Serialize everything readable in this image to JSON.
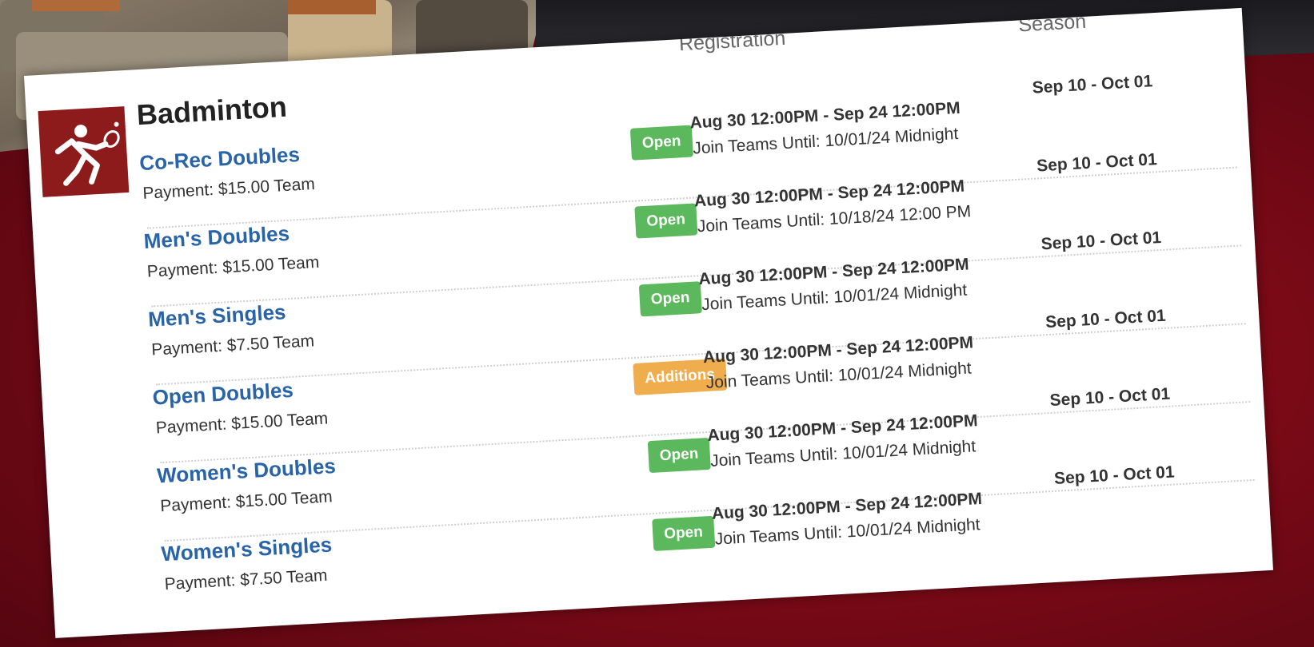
{
  "colors": {
    "open": "#5cb85c",
    "additions": "#f0ad4e",
    "link": "#2a64a8",
    "icon_bg": "#8e1b1b"
  },
  "headers": {
    "registration": "Registration",
    "season": "Season"
  },
  "sport": {
    "title": "Badminton",
    "icon": "badminton-player-icon"
  },
  "leagues": [
    {
      "name": "Co-Rec Doubles",
      "payment": "Payment: $15.00 Team",
      "status": "Open",
      "status_type": "open",
      "registration": "Aug 30 12:00PM - Sep 24 12:00PM",
      "join": "Join Teams Until: 10/01/24 Midnight",
      "season": "Sep 10 - Oct 01"
    },
    {
      "name": "Men's Doubles",
      "payment": "Payment: $15.00 Team",
      "status": "Open",
      "status_type": "open",
      "registration": "Aug 30 12:00PM - Sep 24 12:00PM",
      "join": "Join Teams Until: 10/18/24 12:00 PM",
      "season": "Sep 10 - Oct 01"
    },
    {
      "name": "Men's Singles",
      "payment": "Payment: $7.50 Team",
      "status": "Open",
      "status_type": "open",
      "registration": "Aug 30 12:00PM - Sep 24 12:00PM",
      "join": "Join Teams Until: 10/01/24 Midnight",
      "season": "Sep 10 - Oct 01"
    },
    {
      "name": "Open Doubles",
      "payment": "Payment: $15.00 Team",
      "status": "Additions",
      "status_type": "additions",
      "registration": "Aug 30 12:00PM - Sep 24 12:00PM",
      "join": "Join Teams Until: 10/01/24 Midnight",
      "season": "Sep 10 - Oct 01"
    },
    {
      "name": "Women's Doubles",
      "payment": "Payment: $15.00 Team",
      "status": "Open",
      "status_type": "open",
      "registration": "Aug 30 12:00PM - Sep 24 12:00PM",
      "join": "Join Teams Until: 10/01/24 Midnight",
      "season": "Sep 10 - Oct 01"
    },
    {
      "name": "Women's Singles",
      "payment": "Payment: $7.50 Team",
      "status": "Open",
      "status_type": "open",
      "registration": "Aug 30 12:00PM - Sep 24 12:00PM",
      "join": "Join Teams Until: 10/01/24 Midnight",
      "season": "Sep 10 - Oct 01"
    }
  ]
}
